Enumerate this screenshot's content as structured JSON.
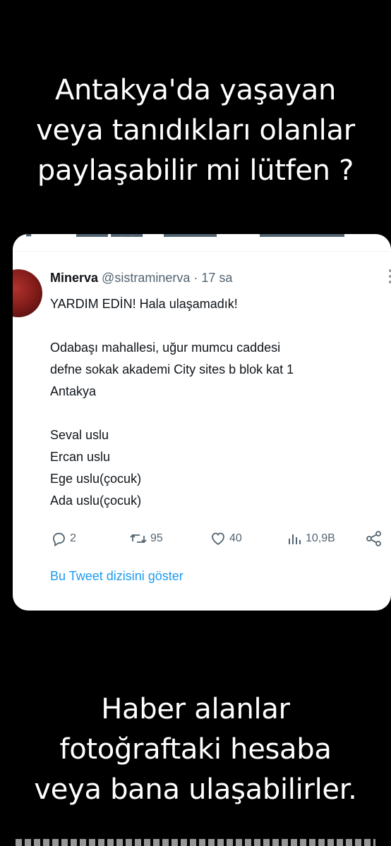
{
  "top_caption": {
    "line1": "Antakya'da yaşayan",
    "line2": "veya tanıdıkları olanlar",
    "line3": "paylaşabilir mi lütfen ?"
  },
  "tweet": {
    "display_name": "Minerva",
    "handle": "@sistraminerva",
    "separator": "·",
    "time": "17 sa",
    "body": {
      "line1": "YARDIM EDİN! Hala ulaşamadık!",
      "line2": "Odabaşı mahallesi, uğur mumcu caddesi",
      "line3": "defne sokak akademi City sites b blok kat 1",
      "line4": "Antakya",
      "line5": "Seval uslu",
      "line6": "Ercan uslu",
      "line7": "Ege uslu(çocuk)",
      "line8": "Ada uslu(çocuk)"
    },
    "actions": {
      "replies": "2",
      "retweets": "95",
      "likes": "40",
      "views": "10,9B"
    },
    "thread_link": "Bu Tweet dizisini göster"
  },
  "bottom_caption": {
    "line1": "Haber alanlar",
    "line2": "fotoğraftaki hesaba",
    "line3": "veya bana ulaşabilirler."
  },
  "colors": {
    "background": "#000000",
    "card": "#ffffff",
    "link_blue": "#1d9bf0",
    "secondary_gray": "#536471"
  },
  "icons": [
    "reply-icon",
    "retweet-icon",
    "like-icon",
    "views-icon",
    "share-icon",
    "more-icon"
  ]
}
